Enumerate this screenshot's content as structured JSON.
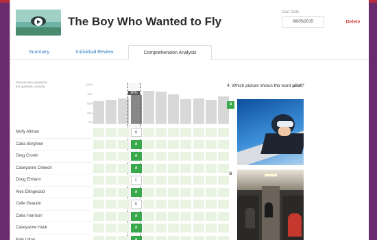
{
  "header": {
    "title": "The Boy Who Wanted to Fly",
    "due_date_label": "Due Date",
    "due_date_value": "08/05/2015",
    "delete_label": "Delete"
  },
  "tabs": [
    {
      "label": "Summary",
      "active": false
    },
    {
      "label": "Individual Review",
      "active": false
    },
    {
      "label": "Comprehension Analysis",
      "active": true
    }
  ],
  "analysis": {
    "panel_label_line1": "Percent who answered",
    "panel_label_line2": "the question correctly",
    "y_ticks": [
      "100%",
      "75%",
      "50%",
      "25%",
      "0%"
    ],
    "selected_column_count": "80%",
    "question_percents": [
      55,
      58,
      62,
      70,
      80,
      78,
      72,
      60,
      62,
      58,
      66
    ],
    "selected_question_index": 3,
    "students": [
      {
        "name": "Molly Altman",
        "answer": "B"
      },
      {
        "name": "Caira Bergmen",
        "answer": "A"
      },
      {
        "name": "Greg Cronin",
        "answer": "A"
      },
      {
        "name": "Caseyanne Dimeon",
        "answer": "A"
      },
      {
        "name": "Doug Ehrlann",
        "answer": "C"
      },
      {
        "name": "Alex Ellingwood",
        "answer": "A"
      },
      {
        "name": "Celle Geaude",
        "answer": "B"
      },
      {
        "name": "Caira Harrison",
        "answer": "A"
      },
      {
        "name": "Caseyanne Hauk",
        "answer": "A"
      },
      {
        "name": "Katy Litton",
        "answer": "A"
      }
    ]
  },
  "question": {
    "prefix": "4. Which picture shows the word ",
    "keyword": "pilot",
    "suffix": "?",
    "option_a_badge": "A",
    "option_b_badge": "B"
  },
  "colors": {
    "accent_red": "#b52d3a",
    "purple_bg": "#6a2b6e",
    "correct_green": "#39a84a",
    "light_green": "#e8f3e2",
    "link_blue": "#2a7bc0"
  }
}
